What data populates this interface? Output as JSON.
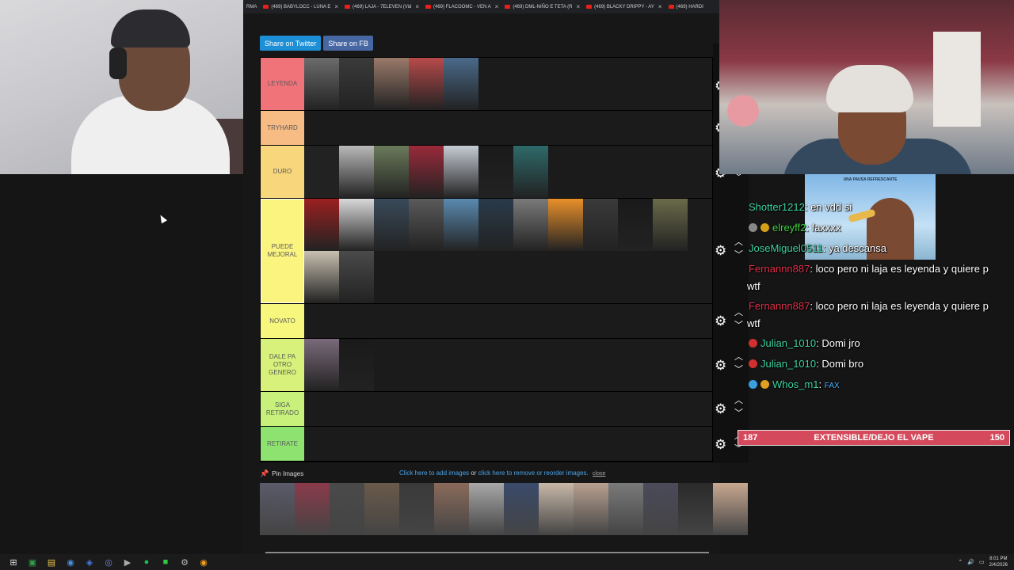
{
  "browser": {
    "tabs": [
      {
        "title": "RMA",
        "has_close": false
      },
      {
        "title": "(469) BABYLOCC - LUNA E",
        "has_close": true
      },
      {
        "title": "(469) LAJA - 7ELEVEN (Vid",
        "has_close": true
      },
      {
        "title": "(469) FLACOOMC - VEN A",
        "has_close": true
      },
      {
        "title": "(469) DML-NIÑO E TETA (R",
        "has_close": true
      },
      {
        "title": "(469) BLACKY DRIPPY - AY",
        "has_close": true
      },
      {
        "title": "(469) HARDI",
        "has_close": false
      }
    ]
  },
  "tiermaker": {
    "share_twitter": "Share on Twitter",
    "share_fb": "Share on FB",
    "tiers": [
      {
        "label": "LEYENDA",
        "colors": [
          "#6b6b6b",
          "#3a3a3a",
          "#9a7a6a",
          "#b84a4a",
          "#4a6a8a"
        ]
      },
      {
        "label": "TRYHARD",
        "colors": []
      },
      {
        "label": "DURO",
        "colors": [
          "#222222",
          "#b9b9b9",
          "#6a7a5a",
          "#9a2a3a",
          "#c6ccd4",
          "#1a1a1a",
          "#2e6a6a"
        ]
      },
      {
        "label": "PUEDE MEJORAL",
        "colors": [
          "#9a2020",
          "#d8d8d8",
          "#3a4a5a",
          "#5a5a5a",
          "#5a8ab0",
          "#2a3a4a",
          "#7a7a7a",
          "#e8902a",
          "#3a3a3a",
          "#1a1a1a",
          "#6a6a4a",
          "#c8c0b0",
          "#4a4a4a"
        ]
      },
      {
        "label": "NOVATO",
        "colors": []
      },
      {
        "label": "DALE PA OTRO GENERO",
        "colors": [
          "#7a6a7a",
          "#1a1a1a"
        ]
      },
      {
        "label": "SIGA RETIRADO",
        "colors": []
      },
      {
        "label": "RETIRATE",
        "colors": []
      }
    ],
    "pin_label": "Pin Images",
    "add_prefix": "Click here to add images",
    "add_or": " or ",
    "add_suffix": "click here to remove or reorder images.",
    "close": "close",
    "pool_colors": [
      "#5a5a6a",
      "#8a3a4a",
      "#4a4a4a",
      "#6a5a4a",
      "#3a3a3a",
      "#8a6a5a",
      "#a8a8a8",
      "#3a4a6a",
      "#c8b8a8",
      "#b8a090",
      "#7a7a7a",
      "#4a4a5a",
      "#2a2a2a",
      "#c8a890"
    ]
  },
  "chat": {
    "ad_title": "UNA PAUSA REFRESCANTE",
    "messages": [
      {
        "user": "Shotter1212",
        "color": "#3fd3a0",
        "text": ": en vdd si",
        "badges": []
      },
      {
        "user": "elreyff2",
        "color": "#3fd340",
        "text": ": faxxxx",
        "badges": [
          "#888888",
          "#d4a017"
        ]
      },
      {
        "user": "JoseMiguel0511",
        "color": "#3fd3a0",
        "text": ": ya descansa",
        "badges": []
      },
      {
        "user": "Fernannn887",
        "color": "#e0304a",
        "text": ": loco pero ni laja es leyenda y quiere p",
        "wrap": "wtf",
        "badges": []
      },
      {
        "user": "Fernannn887",
        "color": "#e0304a",
        "text": ": loco pero ni laja es leyenda y quiere p",
        "wrap": "wtf",
        "badges": []
      },
      {
        "user": "Julian_1010",
        "color": "#3fd3a0",
        "text": ": Domi jro",
        "badges": [
          "#d03030"
        ]
      },
      {
        "user": "Julian_1010",
        "color": "#3fd3a0",
        "text": ": Domi bro",
        "badges": [
          "#d03030"
        ]
      },
      {
        "user": "Whos_m1",
        "color": "#3fd3a0",
        "text": ": ",
        "emote": "FAX",
        "badges": [
          "#3aa0e0",
          "#e0a020"
        ]
      }
    ]
  },
  "goal": {
    "left": "187",
    "label": "EXTENSIBLE/DEJO EL VAPE",
    "right": "150"
  },
  "taskbar": {
    "icons": [
      "windows-icon",
      "terminal-icon",
      "folder-icon",
      "chrome-icon",
      "store-icon",
      "discord-icon",
      "steam-icon",
      "spotify-icon",
      "obs-icon",
      "settings-icon",
      "chrome2-icon"
    ],
    "time": "8:01 PM",
    "date": "2/4/2026"
  }
}
